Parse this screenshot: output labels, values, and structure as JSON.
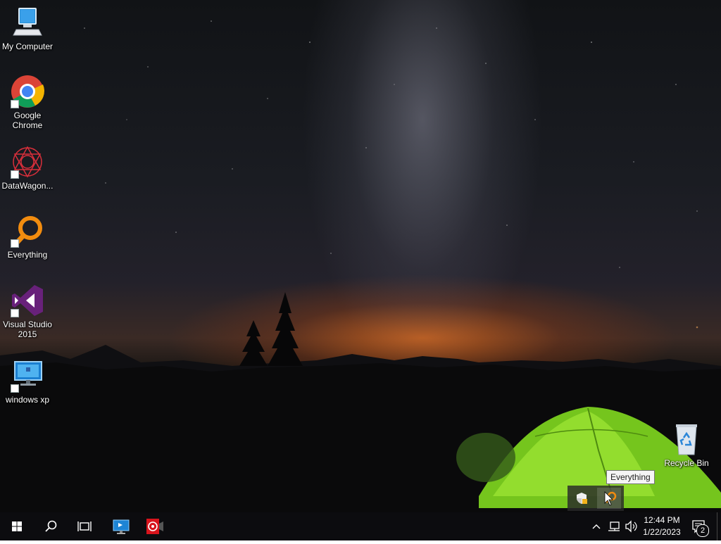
{
  "desktop": {
    "icons": [
      {
        "label": "My Computer",
        "icon": "computer-icon"
      },
      {
        "label": "Google Chrome",
        "icon": "chrome-icon"
      },
      {
        "label": "DataWagon...",
        "icon": "datawagon-icon"
      },
      {
        "label": "Everything",
        "icon": "everything-search-icon"
      },
      {
        "label": "Visual Studio 2015",
        "icon": "visual-studio-icon"
      },
      {
        "label": "windows xp",
        "icon": "virtual-machine-icon"
      },
      {
        "label": "Recycle Bin",
        "icon": "recycle-bin-icon"
      }
    ]
  },
  "tray_popup": {
    "items": [
      "security-shield-icon",
      "everything-tray-icon"
    ],
    "tooltip": "Everything"
  },
  "taskbar": {
    "start": "windows-logo-icon",
    "search": "search-icon",
    "task_view": "task-view-icon",
    "pinned": [
      "remote-desktop-icon",
      "record-app-icon"
    ],
    "tray": {
      "clock_time": "12:44 PM",
      "clock_date": "1/22/2023",
      "notification_count": "2"
    }
  },
  "colors": {
    "taskbar_bg": "#0c0c0f",
    "tent_green": "#7fd620",
    "horizon_orange": "#e06a1e",
    "vs_purple": "#68217a",
    "everything_orange": "#f28c0f"
  }
}
